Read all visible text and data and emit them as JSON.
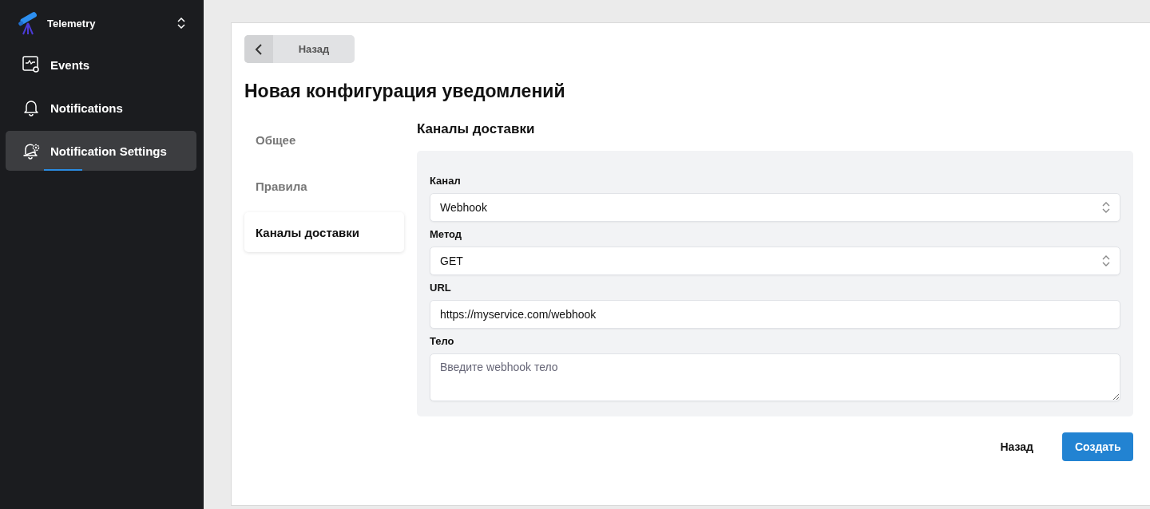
{
  "sidebar": {
    "app": {
      "name": "Telemetry"
    },
    "items": [
      {
        "label": "Events",
        "selected": false
      },
      {
        "label": "Notifications",
        "selected": false
      },
      {
        "label": "Notification Settings",
        "selected": true
      }
    ]
  },
  "back_button": {
    "label": "Назад"
  },
  "title": "Новая конфигурация уведомлений",
  "steps": [
    {
      "label": "Общее",
      "selected": false
    },
    {
      "label": "Правила",
      "selected": false
    },
    {
      "label": "Каналы доставки",
      "selected": true
    }
  ],
  "section": {
    "title": "Каналы доставки",
    "fields": [
      {
        "kind": "select",
        "label": "Канал",
        "value": "Webhook"
      },
      {
        "kind": "select",
        "label": "Метод",
        "value": "GET"
      },
      {
        "kind": "input",
        "label": "URL",
        "value": "https://myservice.com/webhook"
      },
      {
        "kind": "textarea",
        "label": "Тело",
        "placeholder": "Введите webhook тело"
      }
    ]
  },
  "actions": [
    {
      "kind": "secondary",
      "label": "Назад"
    },
    {
      "kind": "primary",
      "label": "Создать"
    }
  ]
}
